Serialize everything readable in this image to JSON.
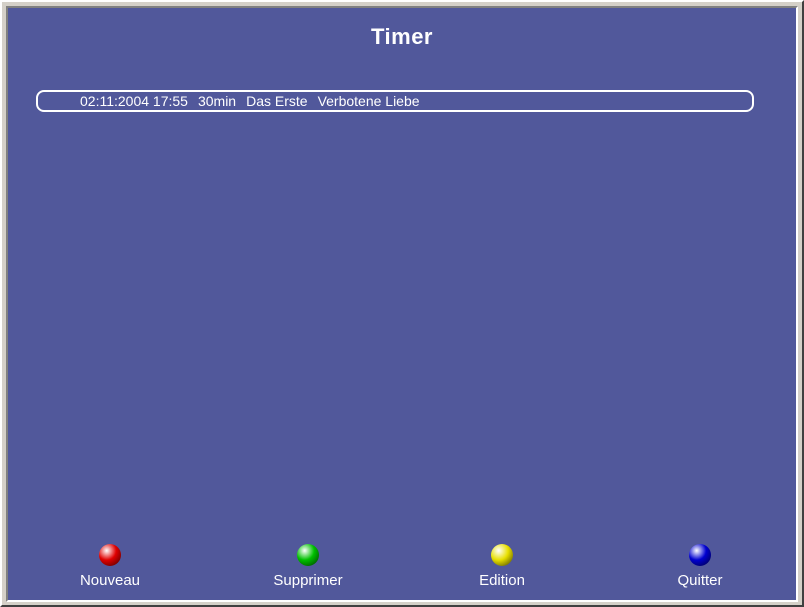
{
  "title": "Timer",
  "timers": [
    {
      "date_time": "02:11:2004 17:55",
      "duration": "30min",
      "channel": "Das Erste",
      "program": "Verbotene Liebe"
    }
  ],
  "buttons": {
    "red": {
      "label": "Nouveau",
      "color": "#e00000"
    },
    "green": {
      "label": "Supprimer",
      "color": "#00c000"
    },
    "yellow": {
      "label": "Edition",
      "color": "#e8e000"
    },
    "blue": {
      "label": "Quitter",
      "color": "#0000d0"
    }
  },
  "colors": {
    "screen_bg": "#51589b",
    "text": "#ffffff"
  }
}
